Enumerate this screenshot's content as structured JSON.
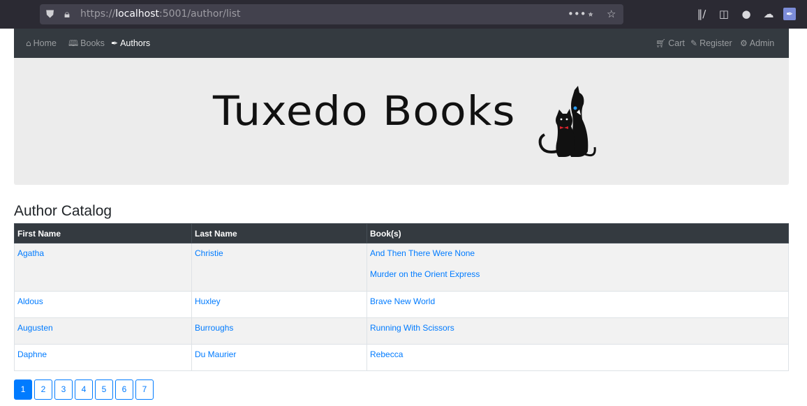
{
  "browser": {
    "url_scheme": "https://",
    "url_host": "localhost",
    "url_rest": ":5001/author/list",
    "icons": [
      "shield-icon",
      "lock-icon",
      "more-icon",
      "pocket-icon",
      "star-icon",
      "library-icon",
      "sidebar-icon",
      "account-icon",
      "sync-icon",
      "extension-icon"
    ]
  },
  "nav": {
    "left": [
      {
        "label": "Home",
        "icon": "home-icon"
      },
      {
        "label": "Books",
        "icon": "book-icon"
      },
      {
        "label": "Authors",
        "icon": "feather-icon"
      }
    ],
    "right": [
      {
        "label": "Cart",
        "icon": "cart-icon"
      },
      {
        "label": "Register",
        "icon": "edit-icon"
      },
      {
        "label": "Admin",
        "icon": "gear-icon"
      }
    ]
  },
  "banner": {
    "logo_text": "Tuxedo Books"
  },
  "catalog": {
    "title": "Author Catalog",
    "headers": [
      "First Name",
      "Last Name",
      "Book(s)"
    ],
    "rows": [
      {
        "first": "Agatha",
        "last": "Christie",
        "books": [
          "And Then There Were None",
          "Murder on the Orient Express"
        ]
      },
      {
        "first": "Aldous",
        "last": "Huxley",
        "books": [
          "Brave New World"
        ]
      },
      {
        "first": "Augusten",
        "last": "Burroughs",
        "books": [
          "Running With Scissors"
        ]
      },
      {
        "first": "Daphne",
        "last": "Du Maurier",
        "books": [
          "Rebecca"
        ]
      }
    ]
  },
  "pagination": {
    "pages": [
      "1",
      "2",
      "3",
      "4",
      "5",
      "6",
      "7"
    ],
    "current": "1"
  },
  "colors": {
    "nav_bg": "#343a40",
    "link": "#007bff",
    "banner_bg": "#ececec"
  }
}
